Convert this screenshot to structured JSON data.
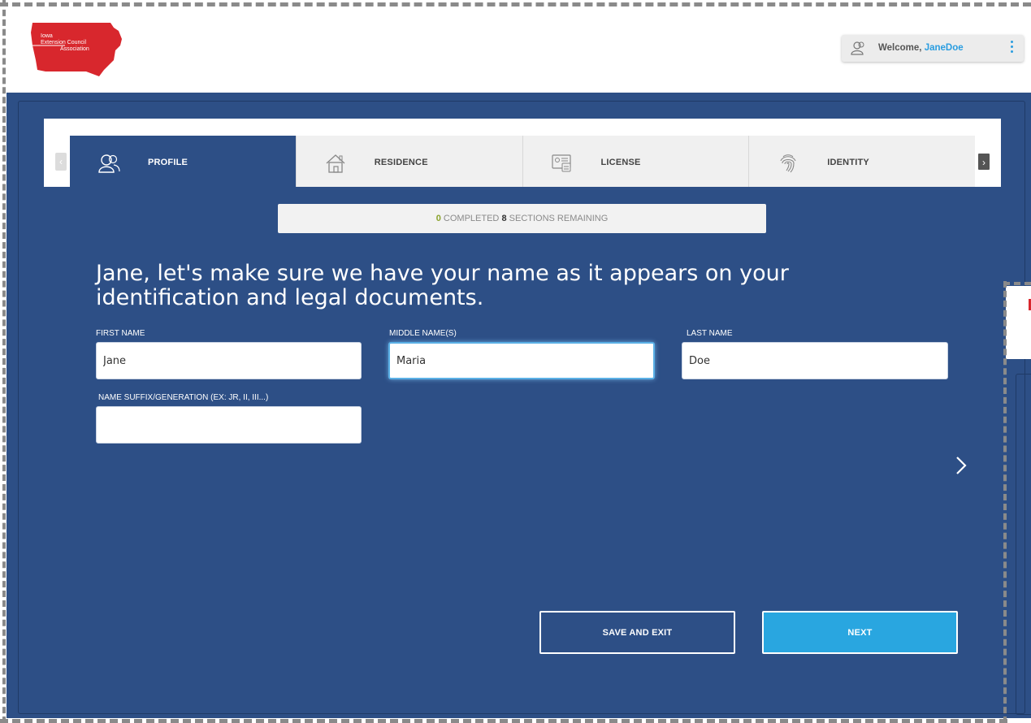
{
  "logo": {
    "line1": "Iowa",
    "line2": "Extension Council",
    "line3": "Association",
    "color": "#d8272d"
  },
  "header": {
    "welcome_prefix": "Welcome,",
    "username": "JaneDoe",
    "user_icon": "user-icon",
    "menu_icon": "kebab-menu-icon"
  },
  "tabs": [
    {
      "label": "PROFILE",
      "icon": "profile-icon",
      "active": true
    },
    {
      "label": "RESIDENCE",
      "icon": "house-icon",
      "active": false
    },
    {
      "label": "LICENSE",
      "icon": "license-card-icon",
      "active": false
    },
    {
      "label": "IDENTITY",
      "icon": "fingerprint-icon",
      "active": false
    }
  ],
  "progress": {
    "completed": "0",
    "completed_label": "COMPLETED",
    "remaining": "8",
    "remaining_label": "SECTIONS REMAINING"
  },
  "form": {
    "headline": "Jane, let's make sure we have your name as it appears on your identification and legal documents.",
    "first_name_label": "FIRST NAME",
    "first_name_value": "Jane",
    "middle_name_label": "MIDDLE NAME(S)",
    "middle_name_value": "Maria",
    "last_name_label": "LAST NAME",
    "last_name_value": "Doe",
    "suffix_label": "NAME SUFFIX/GENERATION (EX: JR, II, III...)",
    "suffix_value": ""
  },
  "actions": {
    "save_exit": "SAVE AND EXIT",
    "next": "NEXT"
  },
  "colors": {
    "primary": "#2d4f86",
    "accent": "#29a6e0",
    "progress_done": "#8aa22b"
  }
}
